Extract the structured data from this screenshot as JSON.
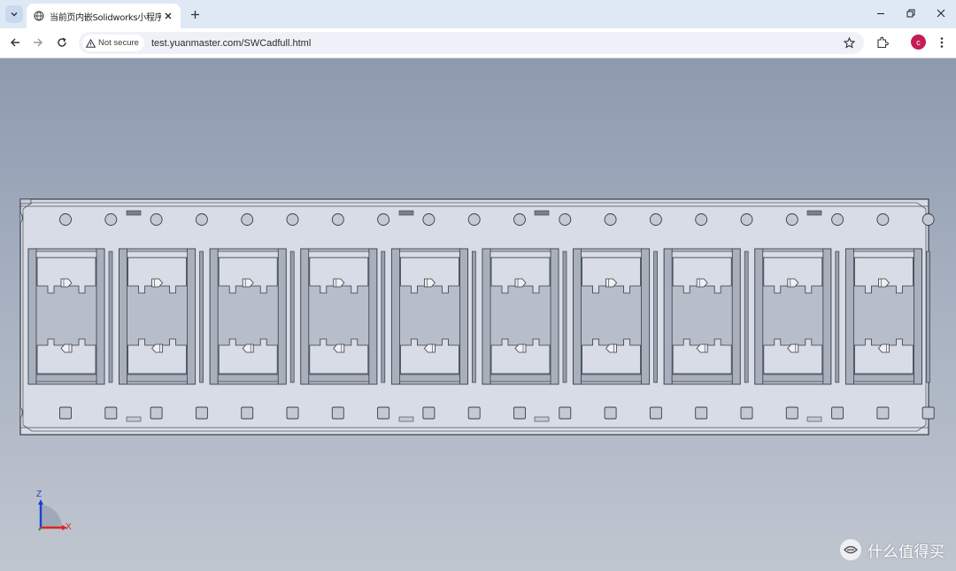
{
  "browser": {
    "tab_title": "当前页内嵌Solidworks小程序演示",
    "security_label": "Not secure",
    "url": "test.yuanmaster.com/SWCadfull.html",
    "profile_initial": "c",
    "icons": [
      "tab-search-icon",
      "globe-icon",
      "close-icon",
      "plus-icon",
      "minimize-icon",
      "restore-icon",
      "close-window-icon",
      "back-arrow-icon",
      "forward-arrow-icon",
      "reload-icon",
      "warning-icon",
      "star-icon",
      "extensions-icon",
      "more-menu-icon"
    ]
  },
  "viewer": {
    "model": "tray",
    "cells": 10,
    "triad": {
      "z_label": "Z",
      "x_label": "X",
      "z_color": "#1a3fd6",
      "x_color": "#e0231e",
      "y_color": "#2a9a3a"
    },
    "background_top": "#8d9aaf",
    "background_bottom": "#c0c6d0",
    "part_fill": "#d8dce6",
    "edge_color": "#3a3d44"
  },
  "watermark": {
    "text": "什么值得买"
  }
}
